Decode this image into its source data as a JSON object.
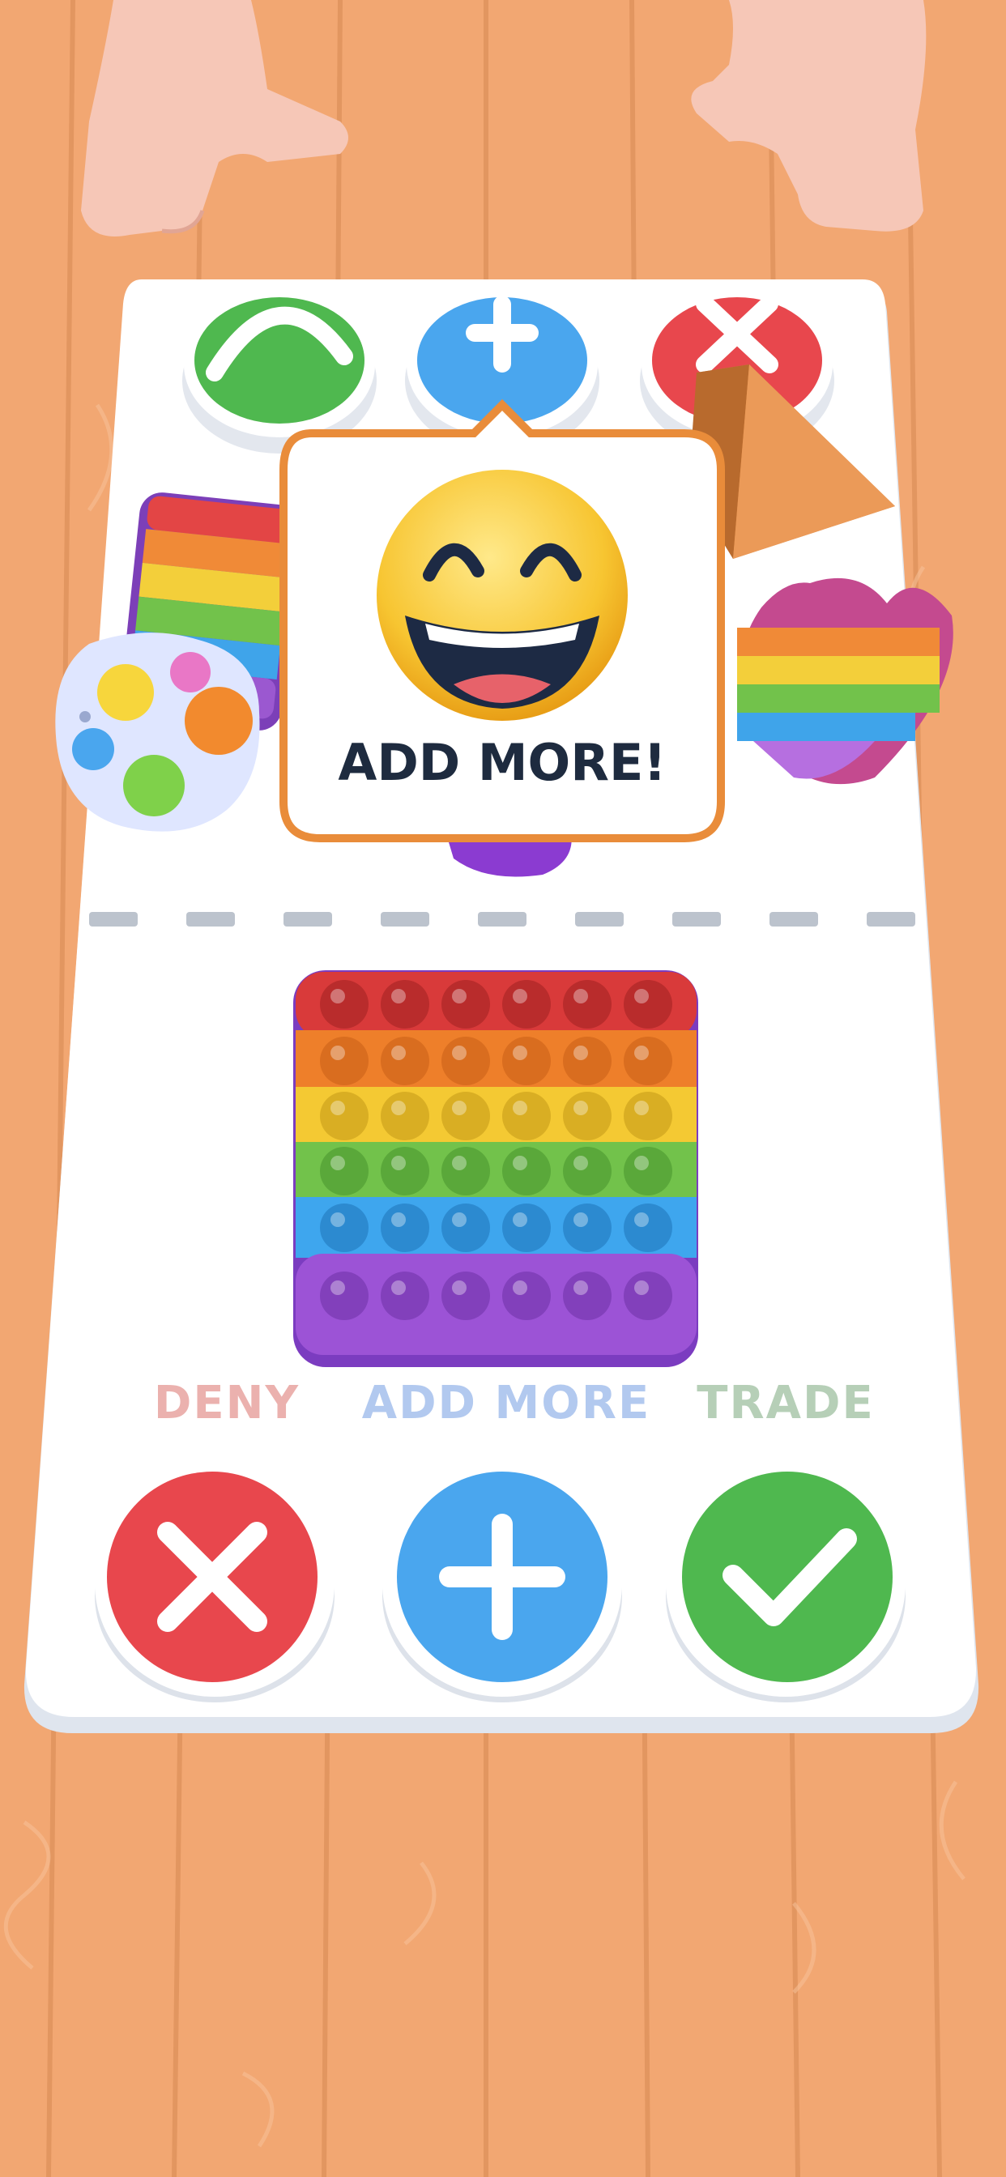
{
  "speech_bubble": {
    "text": "ADD MORE!"
  },
  "choices": {
    "deny_label": "DENY",
    "add_more_label": "ADD MORE",
    "trade_label": "TRADE"
  },
  "colors": {
    "floor": "#f0a36b",
    "board": "#ffffff",
    "deny": "#e8474d",
    "add": "#4aa6ee",
    "trade": "#4fb84f",
    "text_dark": "#1e2b3f"
  }
}
